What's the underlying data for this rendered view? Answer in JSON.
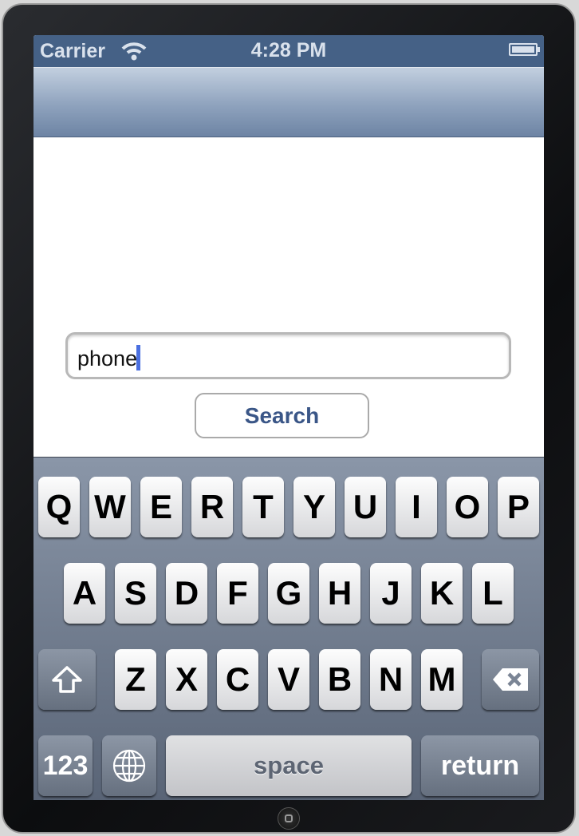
{
  "status_bar": {
    "carrier": "Carrier",
    "time": "4:28 PM",
    "wifi_icon": "wifi-icon",
    "battery_icon": "battery-icon"
  },
  "navbar": {
    "title": ""
  },
  "search_field": {
    "value": "phone",
    "placeholder": ""
  },
  "search_button": {
    "label": "Search"
  },
  "colors": {
    "status_bar": "#456186",
    "button_text": "#3a5687",
    "caret": "#4a6fe0"
  },
  "keyboard": {
    "row1": [
      "Q",
      "W",
      "E",
      "R",
      "T",
      "Y",
      "U",
      "I",
      "O",
      "P"
    ],
    "row2": [
      "A",
      "S",
      "D",
      "F",
      "G",
      "H",
      "J",
      "K",
      "L"
    ],
    "row3": [
      "Z",
      "X",
      "C",
      "V",
      "B",
      "N",
      "M"
    ],
    "shift_icon": "shift-icon",
    "delete_icon": "backspace-icon",
    "numbers_label": "123",
    "globe_icon": "globe-icon",
    "space_label": "space",
    "return_label": "return"
  }
}
